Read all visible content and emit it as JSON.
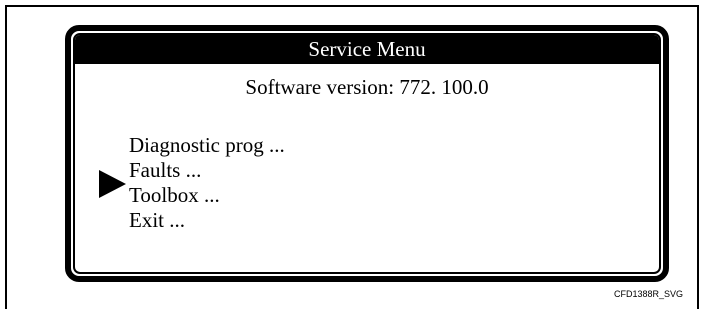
{
  "screen": {
    "title": "Service Menu",
    "version_text": "Software version: 772. 100.0",
    "menu_items": [
      {
        "label": "Diagnostic prog ...",
        "selected": false
      },
      {
        "label": "Faults ...",
        "selected": true
      },
      {
        "label": "Toolbox ...",
        "selected": false
      },
      {
        "label": "Exit ...",
        "selected": false
      }
    ],
    "pointer_icon": "triangle-right-icon"
  },
  "figure": {
    "caption": "CFD1388R_SVG"
  }
}
